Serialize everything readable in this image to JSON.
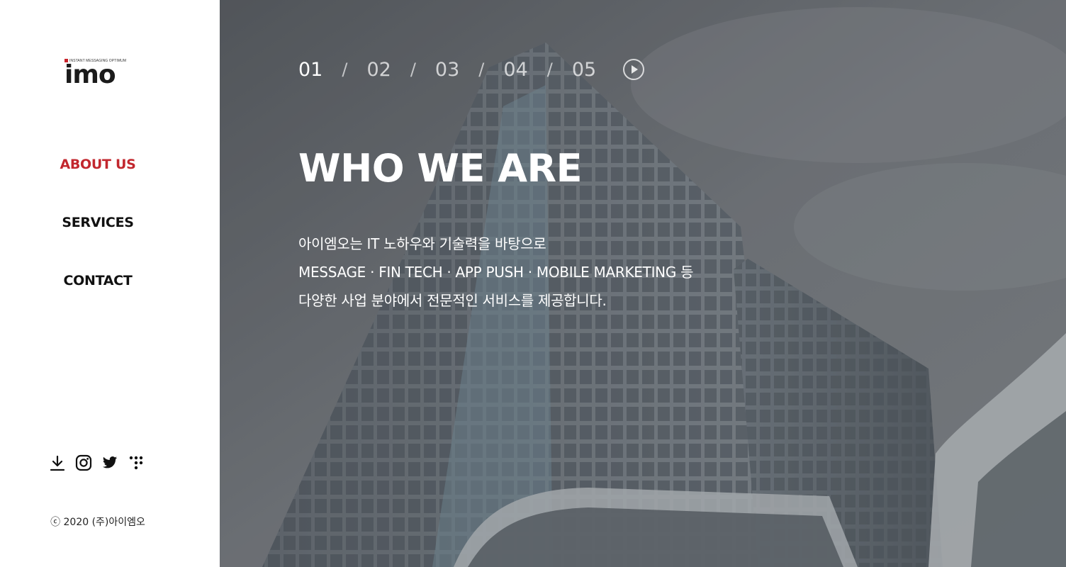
{
  "brand": {
    "tagline": "INSTANT MESSAGING OPTIMUM",
    "logo_text": "imo",
    "accent_color": "#c2272e"
  },
  "nav": {
    "items": [
      {
        "label": "ABOUT US",
        "active": true
      },
      {
        "label": "SERVICES",
        "active": false
      },
      {
        "label": "CONTACT",
        "active": false
      }
    ]
  },
  "social": {
    "icons": [
      "download-icon",
      "instagram-icon",
      "twitter-icon",
      "dots-icon"
    ]
  },
  "footer": {
    "copyright": "ⓒ 2020 (주)아이엠오"
  },
  "slider": {
    "slides": [
      "01",
      "02",
      "03",
      "04",
      "05"
    ],
    "separator": "/",
    "active_index": 0,
    "play_icon": "play-icon"
  },
  "hero": {
    "title": "WHO WE ARE",
    "description": [
      "아이엠오는 IT 노하우와 기술력을 바탕으로",
      "MESSAGE · FIN TECH · APP PUSH · MOBILE MARKETING 등",
      "다양한 사업 분야에서 전문적인 서비스를 제공합니다."
    ]
  }
}
